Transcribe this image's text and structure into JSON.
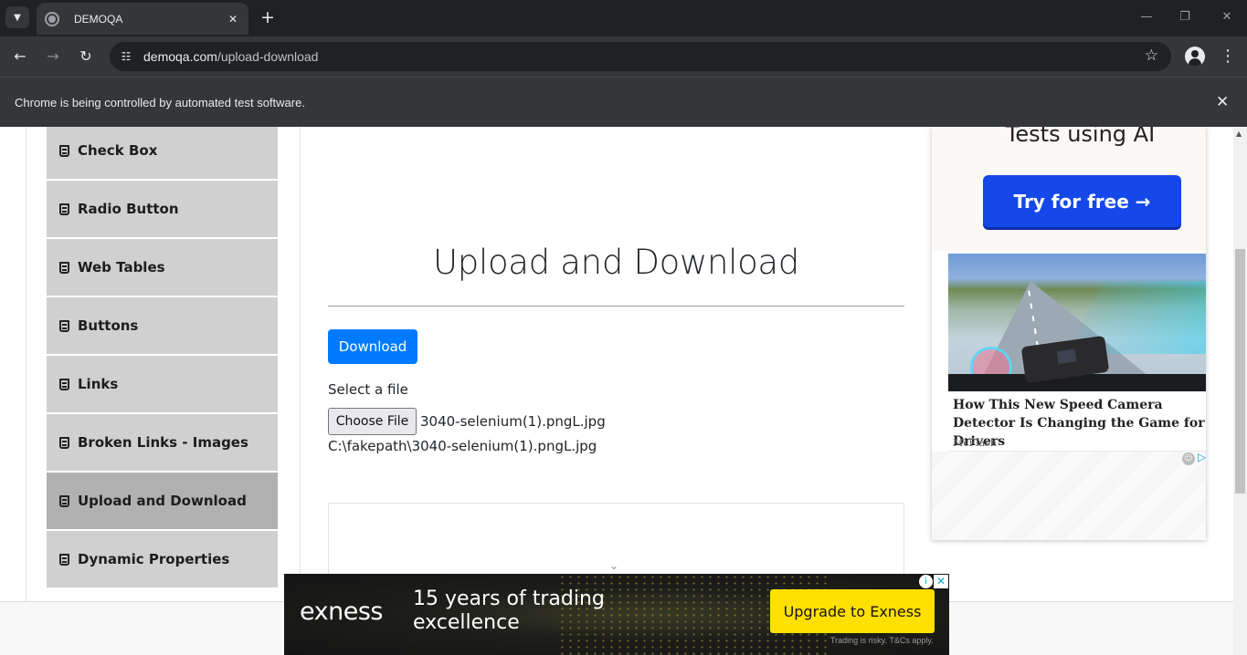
{
  "browser": {
    "tab_title": "DEMOQA",
    "url_host": "demoqa.com",
    "url_path": "/upload-download",
    "infobar_message": "Chrome is being controlled by automated test software."
  },
  "sidebar": {
    "items": [
      {
        "label": "Check Box",
        "active": false
      },
      {
        "label": "Radio Button",
        "active": false
      },
      {
        "label": "Web Tables",
        "active": false
      },
      {
        "label": "Buttons",
        "active": false
      },
      {
        "label": "Links",
        "active": false
      },
      {
        "label": "Broken Links - Images",
        "active": false
      },
      {
        "label": "Upload and Download",
        "active": true
      },
      {
        "label": "Dynamic Properties",
        "active": false
      }
    ]
  },
  "main": {
    "title": "Upload and Download",
    "download_label": "Download",
    "select_label": "Select a file",
    "choose_file_label": "Choose File",
    "chosen_file_name": "3040-selenium(1).pngL.jpg",
    "uploaded_path": "C:\\fakepath\\3040-selenium(1).pngL.jpg"
  },
  "side_ad": {
    "headline": "Tests using AI",
    "button_label": "Try for free →",
    "story_title": "How This New Speed Camera Detector Is Changing the Game for Drivers",
    "story_source": "McFlash"
  },
  "bottom_ad": {
    "brand": "exness",
    "tagline": "15 years of trading excellence",
    "cta_label": "Upgrade to Exness",
    "disclaimer": "Trading is risky. T&Cs apply."
  },
  "colors": {
    "accent_blue": "#007bff",
    "sidebar_bg": "#d0d0d0",
    "sidebar_active_bg": "#b1b1b1",
    "cta_yellow": "#ffe000"
  }
}
